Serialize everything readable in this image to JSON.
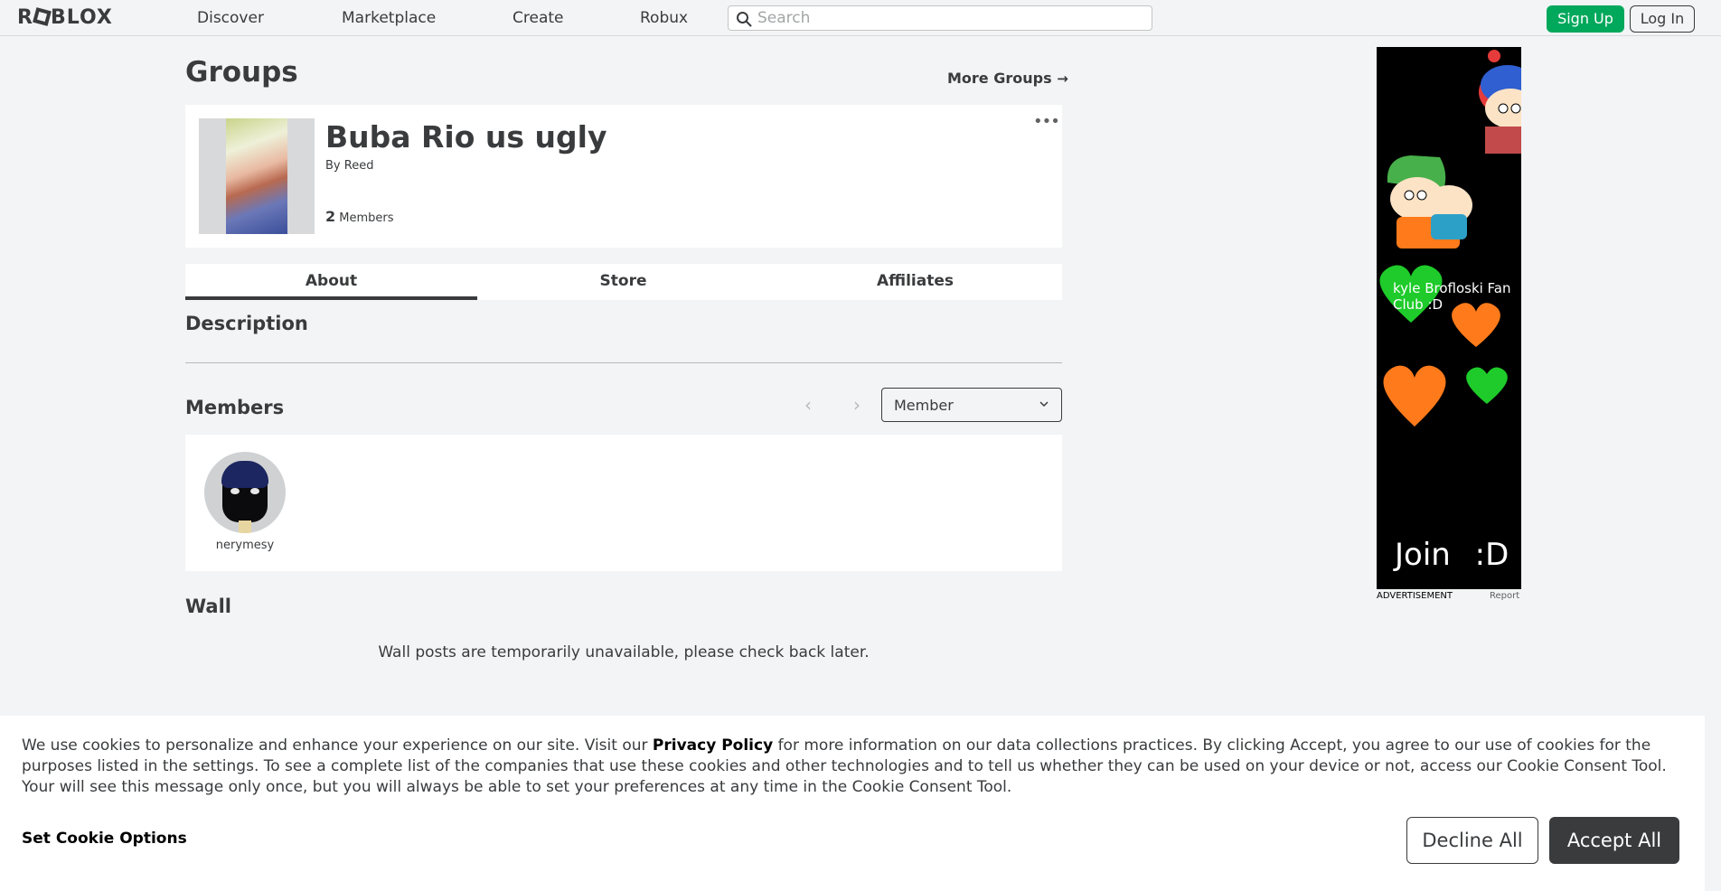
{
  "nav": {
    "logo": "ROBLOX",
    "links": [
      "Discover",
      "Marketplace",
      "Create",
      "Robux"
    ],
    "search_placeholder": "Search",
    "signup_label": "Sign Up",
    "login_label": "Log In"
  },
  "page": {
    "title": "Groups",
    "more_groups": "More Groups"
  },
  "group": {
    "name": "Buba Rio us ugly",
    "by_prefix": "By",
    "owner": "Reed",
    "member_count": "2",
    "member_label": "Members",
    "menu_icon": "ellipsis-icon"
  },
  "tabs": [
    "About",
    "Store",
    "Affiliates"
  ],
  "about": {
    "description_title": "Description",
    "members_title": "Members",
    "role_selected": "Member",
    "members": [
      {
        "name": "nerymesy"
      }
    ],
    "wall_title": "Wall",
    "wall_message": "Wall posts are temporarily unavailable, please check back later."
  },
  "ad": {
    "text": "kyle Brofloski Fan Club :D",
    "join_text": "Join :D",
    "label": "ADVERTISEMENT",
    "report": "Report"
  },
  "cookie": {
    "text_before": "We use cookies to personalize and enhance your experience on our site. Visit our ",
    "privacy_link": "Privacy Policy",
    "text_after": " for more information on our data collections practices. By clicking Accept, you agree to our use of cookies for the purposes listed in the settings. To see a complete list of the companies that use these cookies and other technologies and to tell us whether they can be used on your device or not, access our Cookie Consent Tool. Your will see this message only once, but you will always be able to set your preferences at any time in the Cookie Consent Tool.",
    "set_options": "Set Cookie Options",
    "decline": "Decline All",
    "accept": "Accept All"
  },
  "colors": {
    "signup_green": "#00a85c",
    "dark": "#393b3d",
    "background": "#f2f4f5"
  }
}
